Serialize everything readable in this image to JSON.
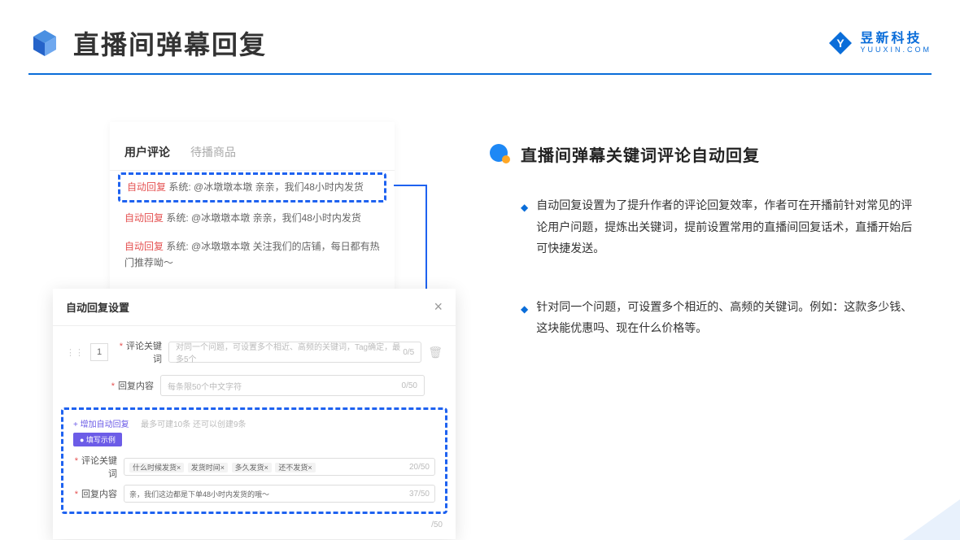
{
  "header": {
    "title": "直播间弹幕回复",
    "brand_name": "昱新科技",
    "brand_url": "YUUXIN.COM"
  },
  "tabs": {
    "active": "用户评论",
    "inactive": "待播商品"
  },
  "comments": {
    "ar_label": "自动回复",
    "sys_label": "系统:",
    "item1": "@冰墩墩本墩 亲亲，我们48小时内发货",
    "item2": "@冰墩墩本墩 亲亲，我们48小时内发货",
    "item3": "@冰墩墩本墩 关注我们的店铺，每日都有热门推荐呦～"
  },
  "modal": {
    "title": "自动回复设置",
    "index": "1",
    "label_keyword": "评论关键词",
    "label_content": "回复内容",
    "placeholder_keyword": "对同一个问题，可设置多个相近、高频的关键词，Tag确定，最多5个",
    "count_keyword": "0/5",
    "placeholder_content": "每条限50个中文字符",
    "count_content": "0/50",
    "add_link": "+ 增加自动回复",
    "add_hint": "最多可建10条 还可以创建9条",
    "example_badge": "● 填写示例",
    "ex_tag1": "什么时候发货×",
    "ex_tag2": "发货时间×",
    "ex_tag3": "多久发货×",
    "ex_tag4": "还不发货×",
    "ex_count1": "20/50",
    "ex_content": "亲，我们这边都是下单48小时内发货的哦～",
    "ex_count2": "37/50",
    "bottom_count": "/50"
  },
  "right": {
    "section_title": "直播间弹幕关键词评论自动回复",
    "bullet1": "自动回复设置为了提升作者的评论回复效率，作者可在开播前针对常见的评论用户问题，提炼出关键词，提前设置常用的直播间回复话术，直播开始后可快捷发送。",
    "bullet2": "针对同一个问题，可设置多个相近的、高频的关键词。例如：这款多少钱、这块能优惠吗、现在什么价格等。"
  }
}
